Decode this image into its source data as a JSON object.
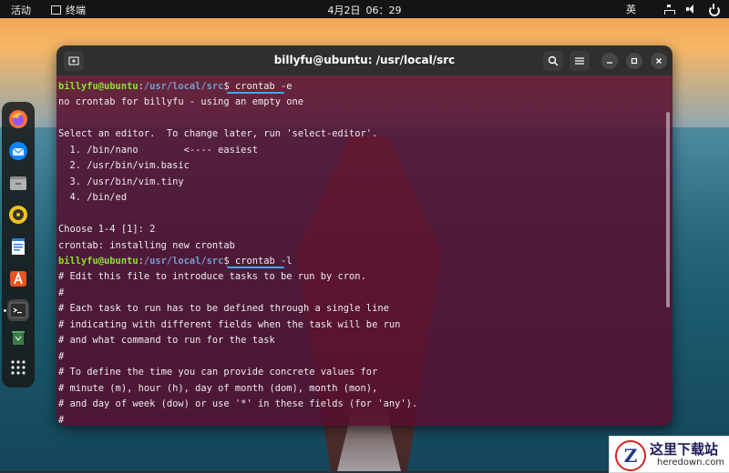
{
  "topbar": {
    "activities": "活动",
    "app_name": "终端",
    "date": "4月2日",
    "time": "06：29",
    "ime": "英"
  },
  "dock": {
    "items": [
      {
        "name": "firefox-icon"
      },
      {
        "name": "thunderbird-icon"
      },
      {
        "name": "files-icon"
      },
      {
        "name": "rhythmbox-icon"
      },
      {
        "name": "libreoffice-writer-icon"
      },
      {
        "name": "app-center-icon"
      },
      {
        "name": "terminal-icon"
      },
      {
        "name": "trash-icon"
      },
      {
        "name": "show-apps-icon"
      }
    ]
  },
  "terminal": {
    "title": "billyfu@ubuntu: /usr/local/src",
    "prompt_user": "billyfu@ubuntu",
    "prompt_sep": ":",
    "prompt_path": "/usr/local/src",
    "prompt_dollar": "$ ",
    "cmd1": "crontab -e",
    "cmd2": "crontab -l",
    "lines": [
      "no crontab for billyfu - using an empty one",
      "",
      "Select an editor.  To change later, run 'select-editor'.",
      "  1. /bin/nano        <---- easiest",
      "  2. /usr/bin/vim.basic",
      "  3. /usr/bin/vim.tiny",
      "  4. /bin/ed",
      "",
      "Choose 1-4 [1]: 2",
      "crontab: installing new crontab"
    ],
    "lines2": [
      "# Edit this file to introduce tasks to be run by cron.",
      "#",
      "# Each task to run has to be defined through a single line",
      "# indicating with different fields when the task will be run",
      "# and what command to run for the task",
      "#",
      "# To define the time you can provide concrete values for",
      "# minute (m), hour (h), day of month (dom), month (mon),",
      "# and day of week (dow) or use '*' in these fields (for 'any').",
      "#"
    ]
  },
  "colors": {
    "terminal_bg": "#560e30",
    "prompt_user": "#8ae234",
    "prompt_path": "#729fcf",
    "highlight": "#3fa9f5"
  },
  "watermark": {
    "cn": "这里下载站",
    "en": "heredown.com",
    "logo_letter": "Z"
  }
}
